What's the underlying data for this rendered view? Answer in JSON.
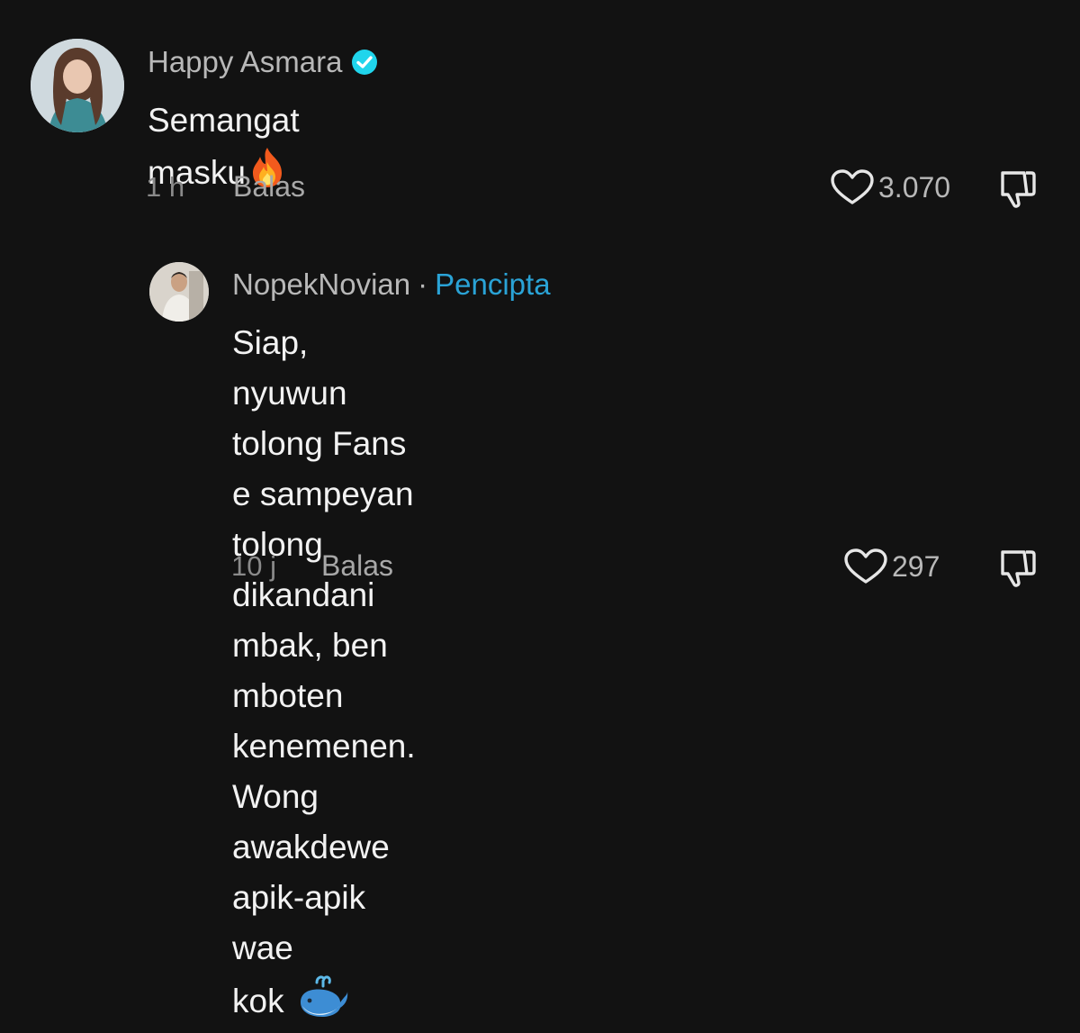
{
  "comments": [
    {
      "author": "Happy Asmara",
      "verified": true,
      "text": "Semangat masku",
      "emoji": "fire-icon",
      "time": "1 h",
      "reply_label": "Balas",
      "likes": "3.070"
    },
    {
      "author": "NopekNovian",
      "separator": "·",
      "role": "Pencipta",
      "text_lines": [
        "Siap, nyuwun tolong Fans e sampeyan",
        "tolong dikandani mbak, ben mboten",
        "kenemenen. Wong awakdewe apik-apik wae",
        "kok"
      ],
      "emoji": "whale-icon",
      "time": "10 j",
      "reply_label": "Balas",
      "likes": "297"
    }
  ],
  "colors": {
    "background": "#121212",
    "creator_accent": "#2aa3d6",
    "verified_badge": "#20d5ec"
  }
}
